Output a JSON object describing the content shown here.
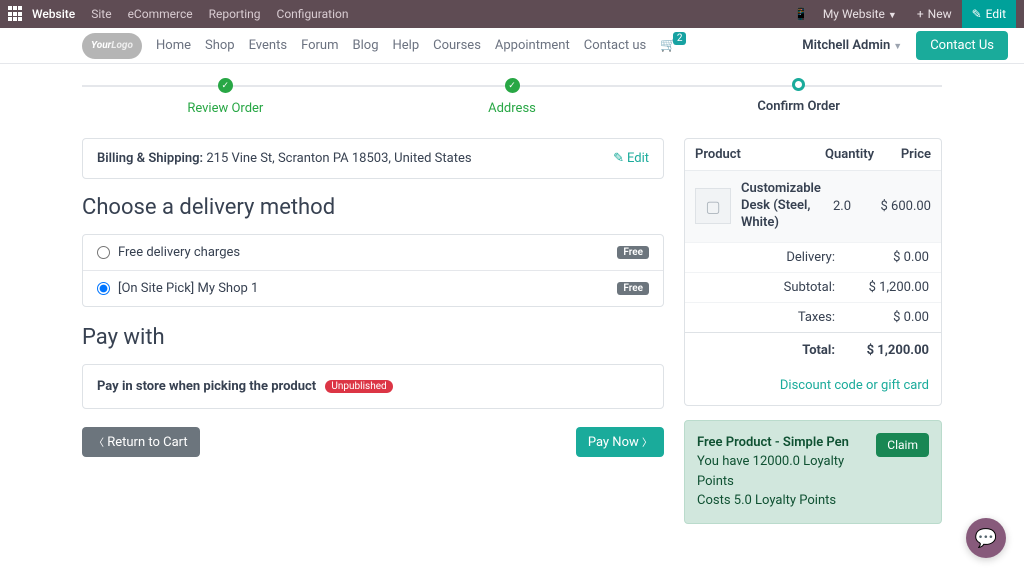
{
  "topbar": {
    "brand": "Website",
    "menu": [
      "Site",
      "eCommerce",
      "Reporting",
      "Configuration"
    ],
    "mywebsite": "My Website",
    "new": "New",
    "edit": "Edit"
  },
  "nav": {
    "items": [
      "Home",
      "Shop",
      "Events",
      "Forum",
      "Blog",
      "Help",
      "Courses",
      "Appointment",
      "Contact us"
    ],
    "cart_count": "2",
    "admin": "Mitchell Admin",
    "contact": "Contact Us"
  },
  "steps": {
    "review": "Review Order",
    "address": "Address",
    "confirm": "Confirm Order"
  },
  "billing": {
    "label": "Billing & Shipping:",
    "address": "215 Vine St, Scranton PA 18503, United States",
    "edit": "Edit"
  },
  "delivery": {
    "title": "Choose a delivery method",
    "opt1": "Free delivery charges",
    "opt2": "[On Site Pick] My Shop 1",
    "free": "Free"
  },
  "pay": {
    "title": "Pay with",
    "text": "Pay in store when picking the product",
    "unpublished": "Unpublished"
  },
  "buttons": {
    "return": "Return to Cart",
    "paynow": "Pay Now"
  },
  "summary": {
    "head_product": "Product",
    "head_qty": "Quantity",
    "head_price": "Price",
    "product_name": "Customizable Desk (Steel, White)",
    "product_qty": "2.0",
    "product_price": "$ 600.00",
    "lines": {
      "delivery_lbl": "Delivery:",
      "delivery_val": "$ 0.00",
      "subtotal_lbl": "Subtotal:",
      "subtotal_val": "$ 1,200.00",
      "taxes_lbl": "Taxes:",
      "taxes_val": "$ 0.00",
      "total_lbl": "Total:",
      "total_val": "$ 1,200.00"
    },
    "discount_link": "Discount code or gift card"
  },
  "promo": {
    "title": "Free Product - Simple Pen",
    "line1": "You have 12000.0 Loyalty Points",
    "line2": "Costs 5.0 Loyalty Points",
    "claim": "Claim"
  }
}
